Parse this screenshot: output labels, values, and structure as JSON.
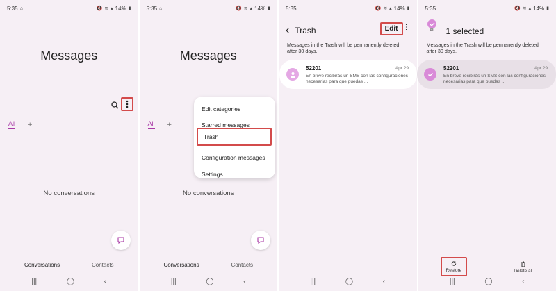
{
  "status": {
    "time": "5:35",
    "battery": "14%"
  },
  "screens": [
    {
      "title": "Messages",
      "tabs": {
        "all": "All",
        "add": "+"
      },
      "empty_text": "No conversations",
      "bottom_tabs": {
        "conversations": "Conversations",
        "contacts": "Contacts"
      }
    },
    {
      "title": "Messages",
      "tabs": {
        "all": "All",
        "add": "+"
      },
      "empty_text": "No conversations",
      "bottom_tabs": {
        "conversations": "Conversations",
        "contacts": "Contacts"
      },
      "menu": [
        "Edit categories",
        "Starred messages",
        "Trash",
        "Configuration messages",
        "Settings"
      ]
    },
    {
      "header": {
        "back": "‹",
        "title": "Trash",
        "edit": "Edit",
        "more": "⋮"
      },
      "note": "Messages in the Trash will be permanently deleted after 30 days.",
      "message": {
        "sender": "52201",
        "date": "Apr 29",
        "preview": "En breve recibirás un SMS con las configuraciones necesarias para que puedas ..."
      }
    },
    {
      "header": {
        "all_label": "All",
        "selected_text": "1 selected"
      },
      "note": "Messages in the Trash will be permanently deleted after 30 days.",
      "message": {
        "sender": "52201",
        "date": "Apr 29",
        "preview": "En breve recibirás un SMS con las configuraciones necesarias para que puedas ..."
      },
      "actions": {
        "restore": "Restore",
        "delete_all": "Delete all"
      }
    }
  ],
  "colors": {
    "accent": "#a83aa6",
    "highlight_box": "#d34b4b",
    "avatar": "#e4a8e4",
    "selected_bg": "#e8e0e7"
  },
  "icons": {
    "search": "search-icon",
    "more": "more-vert-icon",
    "compose": "compose-icon",
    "nav_recent": "nav-recents-icon",
    "nav_home": "nav-home-icon",
    "nav_back": "nav-back-icon",
    "restore": "restore-icon",
    "delete": "trash-icon"
  }
}
